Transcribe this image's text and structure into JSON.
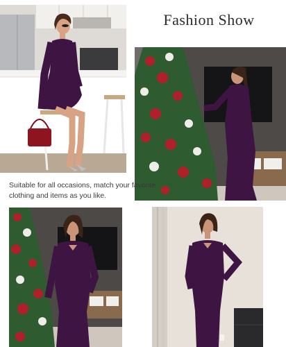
{
  "heading": {
    "title": "Fashion Show"
  },
  "caption": {
    "line1": "Suitable for all occasions, match your favorite",
    "line2": "clothing and items as you like."
  },
  "colors": {
    "dress": "#3d1442",
    "tree": "#2e5b2f",
    "ornament": "#b0202a"
  }
}
